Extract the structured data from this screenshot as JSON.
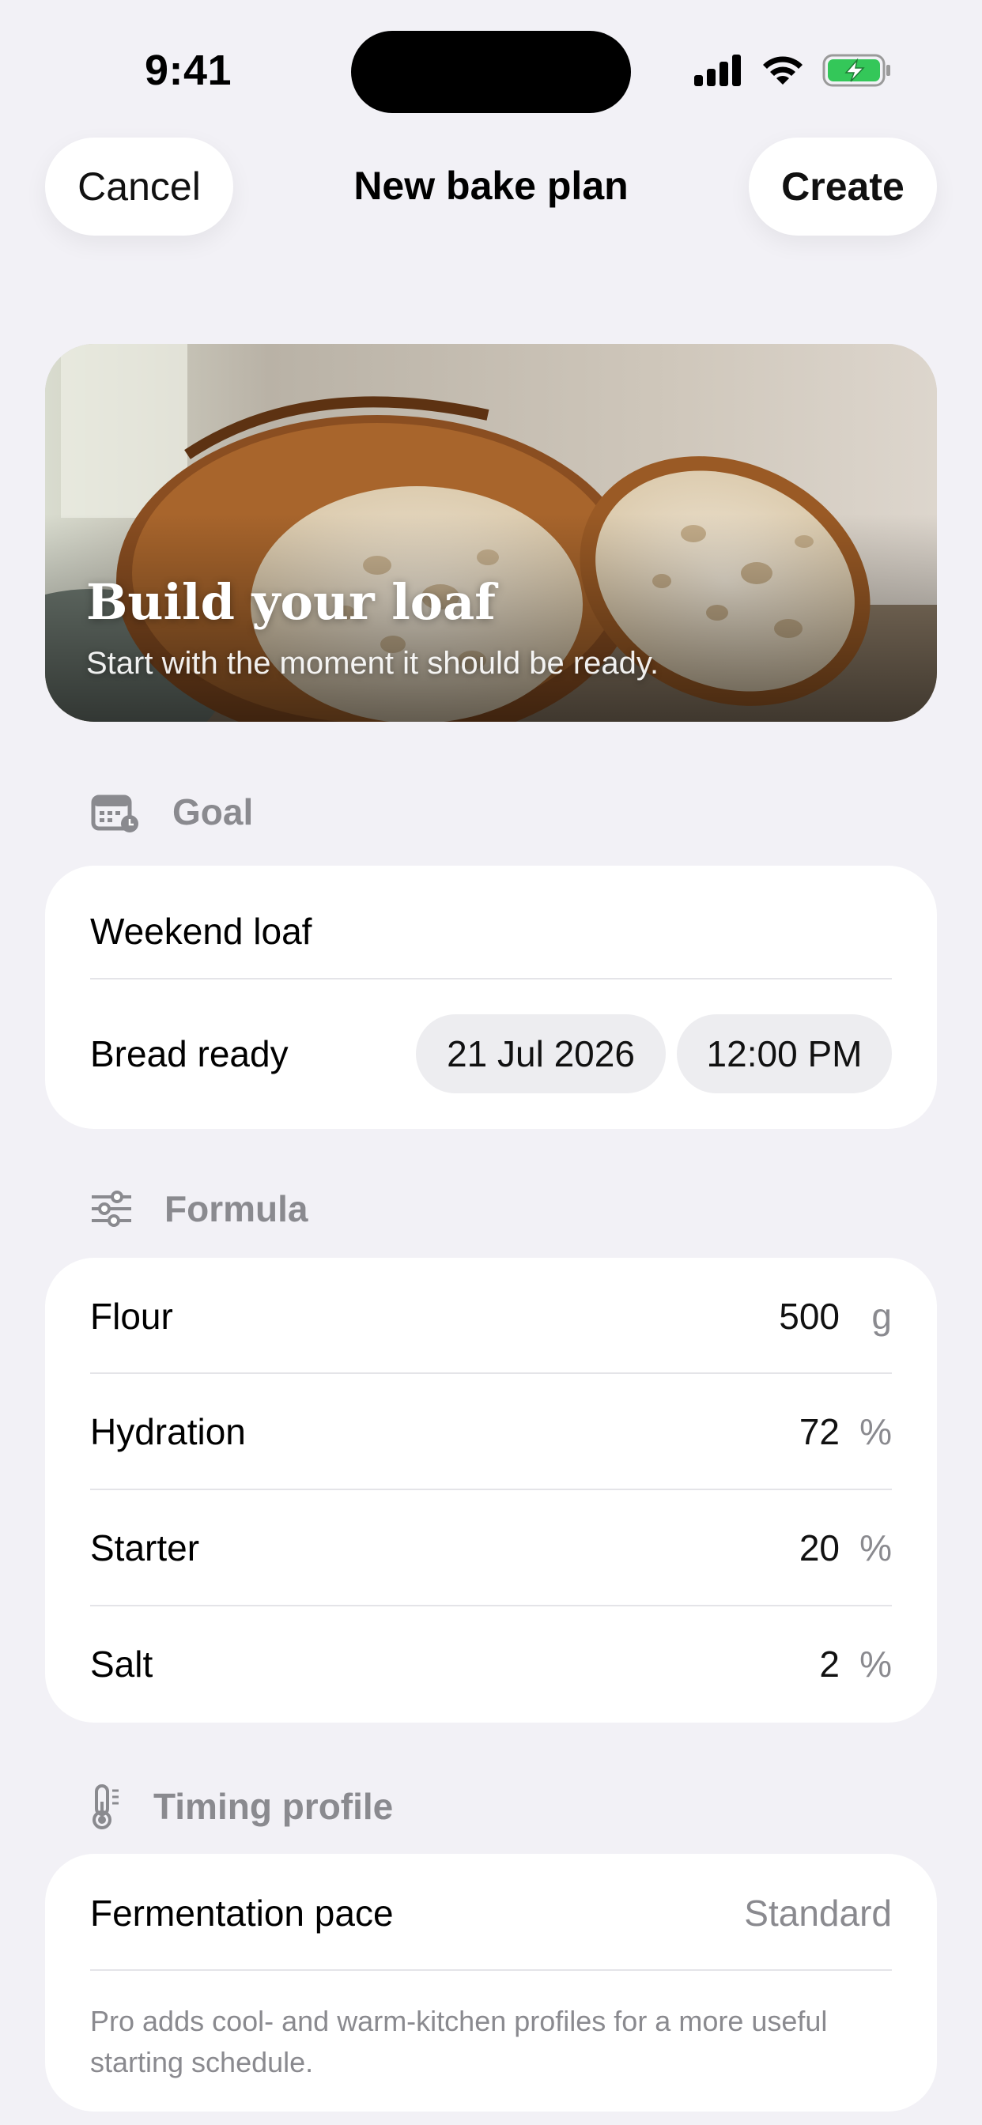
{
  "status_bar": {
    "time": "9:41"
  },
  "nav": {
    "cancel_label": "Cancel",
    "title": "New bake plan",
    "create_label": "Create"
  },
  "hero": {
    "title": "Build your loaf",
    "subtitle": "Start with the moment it should be ready."
  },
  "goal": {
    "section_label": "Goal",
    "name_value": "Weekend loaf",
    "ready_label": "Bread ready",
    "date_value": "21 Jul 2026",
    "time_value": "12:00 PM"
  },
  "formula": {
    "section_label": "Formula",
    "rows": [
      {
        "label": "Flour",
        "value": "500",
        "unit": "g"
      },
      {
        "label": "Hydration",
        "value": "72",
        "unit": "%"
      },
      {
        "label": "Starter",
        "value": "20",
        "unit": "%"
      },
      {
        "label": "Salt",
        "value": "2",
        "unit": "%"
      }
    ]
  },
  "timing": {
    "section_label": "Timing profile",
    "pace_label": "Fermentation pace",
    "pace_value": "Standard",
    "footnote": "Pro adds cool- and warm-kitchen profiles for a more useful starting schedule."
  },
  "colors": {
    "background": "#f2f1f6",
    "card": "#ffffff",
    "muted": "#8a8a8f",
    "battery": "#34c759"
  }
}
